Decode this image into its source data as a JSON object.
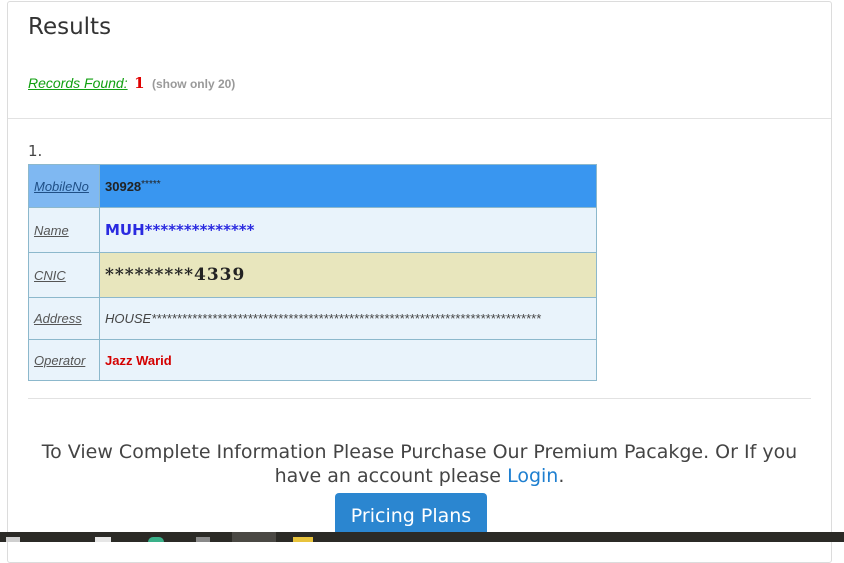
{
  "panel": {
    "title": "Results"
  },
  "records": {
    "label": "Records Found:",
    "count": "1",
    "note": "(show only 20)"
  },
  "result": {
    "index": "1.",
    "rows": {
      "mobile": {
        "label": "MobileNo",
        "value": "30928",
        "masked": "*****"
      },
      "name": {
        "label": "Name",
        "value": "MUH**************"
      },
      "cnic": {
        "label": "CNIC",
        "value": "*********4339"
      },
      "address": {
        "label": "Address",
        "value": "HOUSE*****************************************************************************"
      },
      "operator": {
        "label": "Operator",
        "value": "Jazz Warid"
      }
    }
  },
  "notice": {
    "text": "To View Complete Information Please Purchase Our Premium Pacakge. Or If you have an account please",
    "login_label": "Login",
    "suffix": "."
  },
  "pricing_button": {
    "label": "Pricing Plans"
  },
  "colors": {
    "mobile_row": "#3996f0",
    "cnic_row": "#e8e6bd",
    "link_green": "#12a012",
    "operator_red": "#d40000",
    "button_blue": "#2b86d0"
  },
  "taskbar": {
    "icons": [
      "windows-icon",
      "file-explorer-icon",
      "chrome-icon",
      "app-icon",
      "active-window-icon",
      "folder-icon"
    ]
  }
}
